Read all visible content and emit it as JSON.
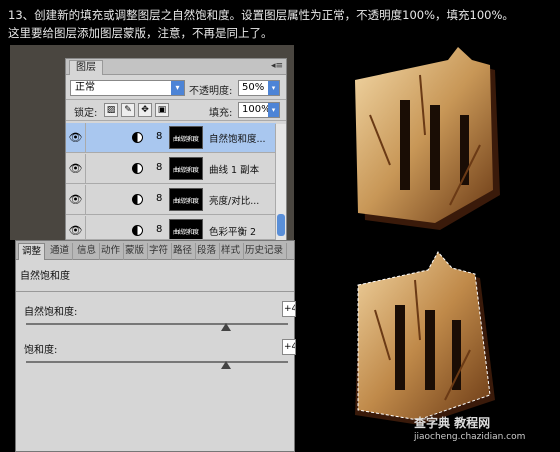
{
  "instruction": {
    "line1": "13、创建新的填充或调整图层之自然饱和度。设置图层属性为正常，不透明度100%，填充100%。",
    "line2": "这里要给图层添加图层蒙版，注意，不再是同上了。"
  },
  "layers_panel": {
    "tab": "图层",
    "blend_mode": "正常",
    "opacity_label": "不透明度:",
    "opacity_value": "50%",
    "lock_label": "锁定:",
    "fill_label": "填充:",
    "fill_value": "100%",
    "layers": [
      {
        "name": "自然饱和度...",
        "selected": true
      },
      {
        "name": "曲线 1 副本",
        "selected": false
      },
      {
        "name": "亮度/对比...",
        "selected": false
      },
      {
        "name": "色彩平衡 2",
        "selected": false
      }
    ],
    "mask_text": "曲线饱和度"
  },
  "adjustments_panel": {
    "tabs": [
      "调整",
      "通道",
      "信息",
      "动作",
      "蒙版",
      "字符",
      "路径",
      "段落",
      "样式",
      "历史记录"
    ],
    "active_tab": "调整",
    "title": "自然饱和度",
    "sliders": [
      {
        "label": "自然饱和度:",
        "value": "+4"
      },
      {
        "label": "饱和度:",
        "value": "+4"
      }
    ]
  },
  "watermark": {
    "main": "查字典 教程网",
    "url": "jiaocheng.chazidian.com"
  },
  "colors": {
    "selection": "#a9c7ef",
    "panel": "#d6d6d6",
    "accent": "#4d84d6"
  }
}
